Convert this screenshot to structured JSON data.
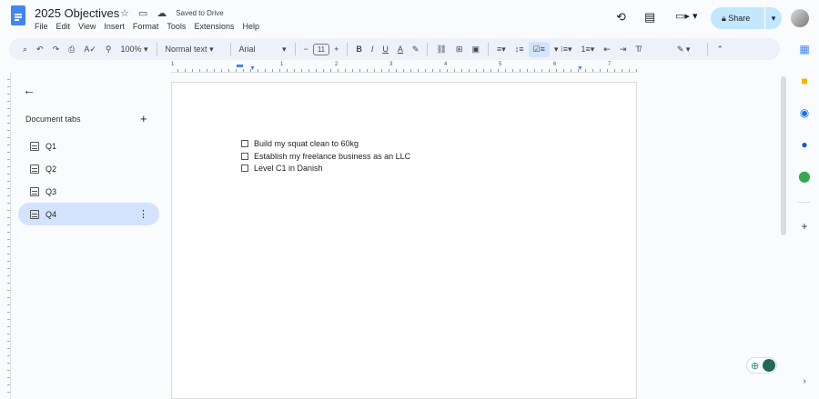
{
  "header": {
    "title": "2025 Objectives",
    "saved_status": "Saved to Drive",
    "share_label": "Share"
  },
  "menu": [
    "File",
    "Edit",
    "View",
    "Insert",
    "Format",
    "Tools",
    "Extensions",
    "Help"
  ],
  "toolbar": {
    "zoom": "100%",
    "style": "Normal text",
    "font": "Arial",
    "font_size": "11"
  },
  "ruler": [
    "1",
    "1",
    "2",
    "3",
    "4",
    "5",
    "6",
    "7"
  ],
  "sidebar": {
    "heading": "Document tabs",
    "tabs": [
      {
        "label": "Q1"
      },
      {
        "label": "Q2"
      },
      {
        "label": "Q3"
      },
      {
        "label": "Q4",
        "active": true
      }
    ]
  },
  "document": {
    "checklist": [
      "Build my squat clean to 60kg",
      "Establish my freelance business as an LLC",
      "Level C1 in Danish"
    ]
  },
  "colors": {
    "accent": "#d3e3fd",
    "share": "#c2e7ff",
    "docs_blue": "#4285f4"
  }
}
